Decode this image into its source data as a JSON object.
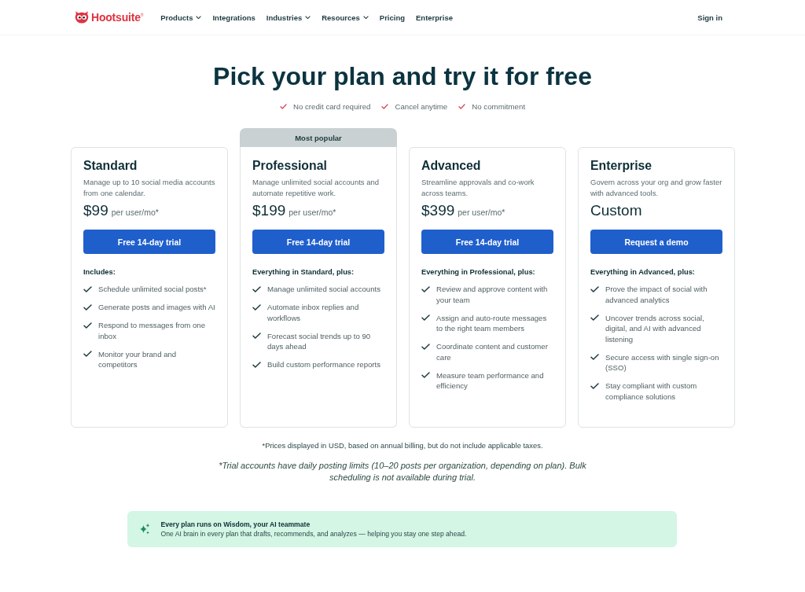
{
  "nav": {
    "logo": "Hootsuite$^{®}$",
    "items": [
      {
        "label": "Products",
        "dropdown": true
      },
      {
        "label": "Integrations",
        "dropdown": false
      },
      {
        "label": "Industries",
        "dropdown": true
      },
      {
        "label": "Resources",
        "dropdown": true
      },
      {
        "label": "Pricing",
        "dropdown": false
      },
      {
        "label": "Enterprise",
        "dropdown": false
      }
    ],
    "sign_in": "Sign in"
  },
  "hero": {
    "title": "Pick your plan and try it for free",
    "perks": [
      "No credit card required",
      "Cancel anytime",
      "No commitment"
    ]
  },
  "plans": [
    {
      "name": "Standard",
      "description": "Manage up to 10 social media accounts from one calendar.",
      "price": "$99",
      "price_unit": "per user/mo*",
      "button": "Free 14-day trial",
      "features_heading": "Includes:",
      "features": [
        "Schedule unlimited social posts*",
        "Generate posts and images with AI",
        "Respond to messages from one inbox",
        "Monitor your brand and competitors"
      ]
    },
    {
      "badge": "Most popular",
      "name": "Professional",
      "description": "Manage unlimited social accounts and automate repetitive work.",
      "price": "$199",
      "price_unit": "per user/mo*",
      "button": "Free 14-day trial",
      "features_heading": "Everything in Standard, plus:",
      "features": [
        "Manage unlimited social accounts",
        "Automate inbox replies and workflows",
        "Forecast social trends up to 90 days ahead",
        "Build custom performance reports"
      ]
    },
    {
      "name": "Advanced",
      "description": "Streamline approvals and co-work across teams.",
      "price": "$399",
      "price_unit": "per user/mo*",
      "button": "Free 14-day trial",
      "features_heading": "Everything in Professional, plus:",
      "features": [
        "Review and approve content with your team",
        "Assign and auto-route messages to the right team members",
        "Coordinate content and customer care",
        "Measure team performance and efficiency"
      ]
    },
    {
      "name": "Enterprise",
      "description": "Govern across your org and grow faster with advanced tools.",
      "price": "Custom",
      "button": "Request a demo",
      "features_heading": "Everything in Advanced, plus:",
      "features": [
        "Prove the impact of social with advanced analytics",
        "Uncover trends across social, digital, and AI with advanced listening",
        "Secure access with single sign-on (SSO)",
        "Stay compliant with custom compliance solutions"
      ]
    }
  ],
  "notes": [
    {
      "kind": "plain",
      "text": "*Prices displayed in USD, based on annual billing, but do not include applicable taxes."
    },
    {
      "kind": "italic",
      "text": "*Trial accounts have daily posting limits (10–20 posts per organization, depending on plan). Bulk scheduling is not available during trial."
    }
  ],
  "ai_banner": {
    "title": "Every plan runs on Wisdom, your AI teammate",
    "text": "One AI brain in every plan that drafts, recommends, and analyzes — helping you stay one step ahead."
  }
}
